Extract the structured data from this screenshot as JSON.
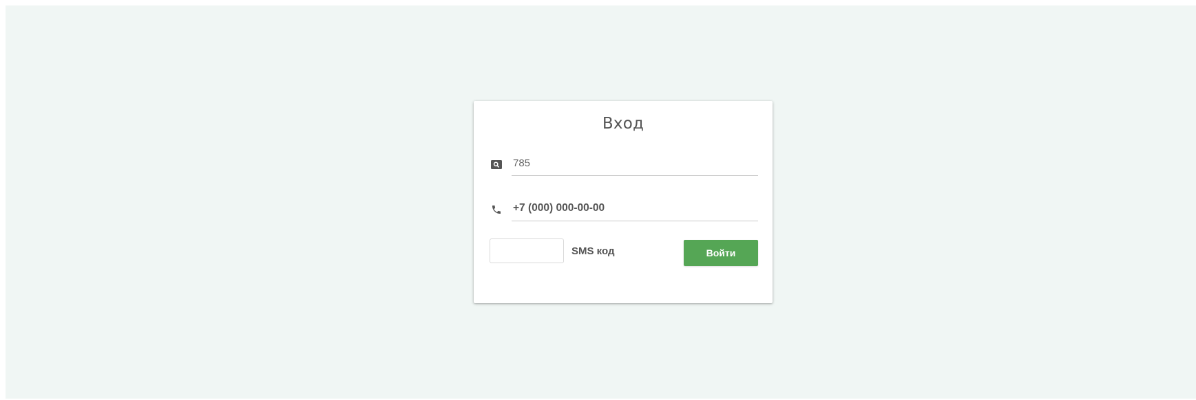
{
  "login": {
    "title": "Вход",
    "id_field": {
      "icon": "search-card-icon",
      "value": "785",
      "placeholder": ""
    },
    "phone_field": {
      "icon": "phone-icon",
      "value": "",
      "placeholder": "+7 (000) 000-00-00"
    },
    "sms_field": {
      "value": "",
      "label": "SMS код"
    },
    "submit_label": "Войти"
  },
  "colors": {
    "page_background": "#f0f6f4",
    "card_background": "#ffffff",
    "button_green": "#55a655",
    "icon_gray": "#555555"
  }
}
